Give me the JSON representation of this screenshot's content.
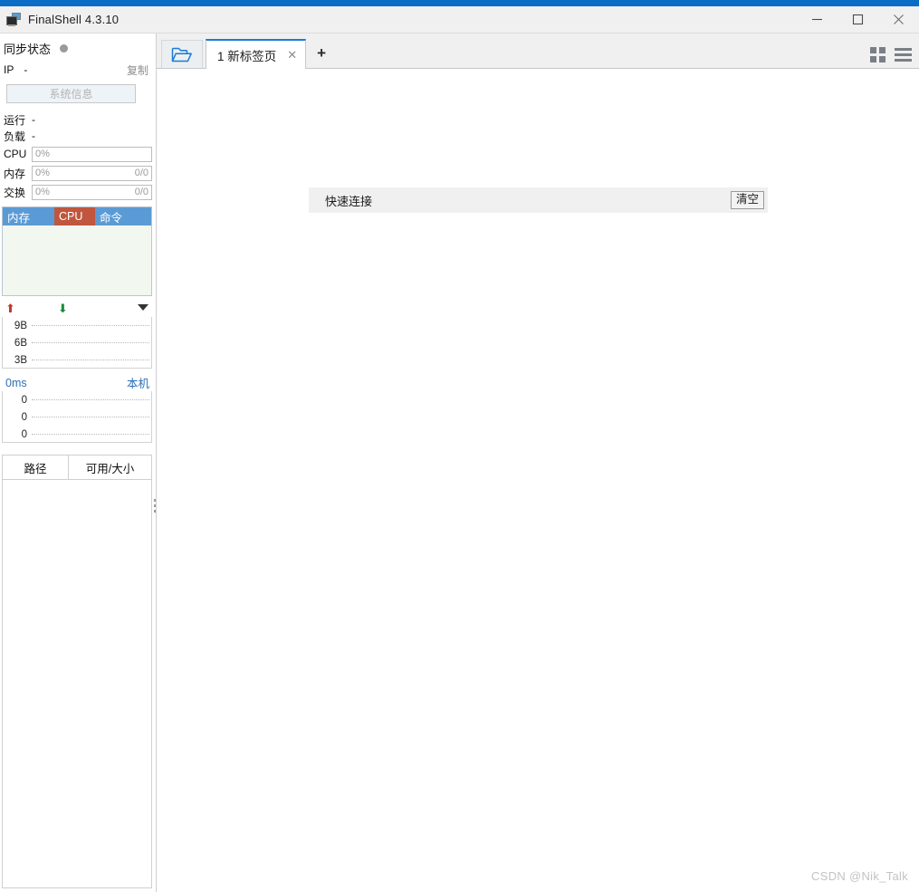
{
  "window": {
    "title": "FinalShell 4.3.10",
    "app_icon": "monitor-icon",
    "minimize_label": "—",
    "maximize_label": "□",
    "close_label": "✕"
  },
  "sidebar": {
    "sync": {
      "label": "同步状态",
      "status_dot": "offline-dot"
    },
    "ip": {
      "key": "IP",
      "value": "-",
      "copy_label": "复制"
    },
    "system_info_button": "系统信息",
    "stats": [
      {
        "key": "运行",
        "value": "-"
      },
      {
        "key": "负载",
        "value": "-"
      }
    ],
    "bars": [
      {
        "key": "CPU",
        "percent": "0%",
        "detail": ""
      },
      {
        "key": "内存",
        "percent": "0%",
        "detail": "0/0"
      },
      {
        "key": "交换",
        "percent": "0%",
        "detail": "0/0"
      }
    ],
    "process_table": {
      "columns": [
        "内存",
        "CPU",
        "命令"
      ],
      "rows": [],
      "header_color": "#5b9bd5",
      "active_column_color": "#c0563d",
      "body_color": "#f2f7f0"
    },
    "network_graph": {
      "upload_icon": "arrow-up-icon",
      "download_icon": "arrow-down-icon",
      "expand_icon": "caret-down-icon",
      "ticks": [
        "9B",
        "6B",
        "3B"
      ]
    },
    "ping_graph": {
      "latency": "0ms",
      "host": "本机",
      "ticks": [
        "0",
        "0",
        "0"
      ]
    },
    "disk_table": {
      "columns": [
        "路径",
        "可用/大小"
      ],
      "rows": []
    }
  },
  "toolbar": {
    "folder_icon": "open-folder-icon",
    "tabs": [
      {
        "label": "1 新标签页",
        "close_label": "✕",
        "active": true
      }
    ],
    "add_tab_label": "+",
    "grid_view_icon": "grid-view-icon",
    "list_view_icon": "list-view-icon"
  },
  "main": {
    "quick_connect": {
      "label": "快速连接",
      "clear_button": "清空"
    },
    "watermark": "CSDN @Nik_Talk"
  }
}
